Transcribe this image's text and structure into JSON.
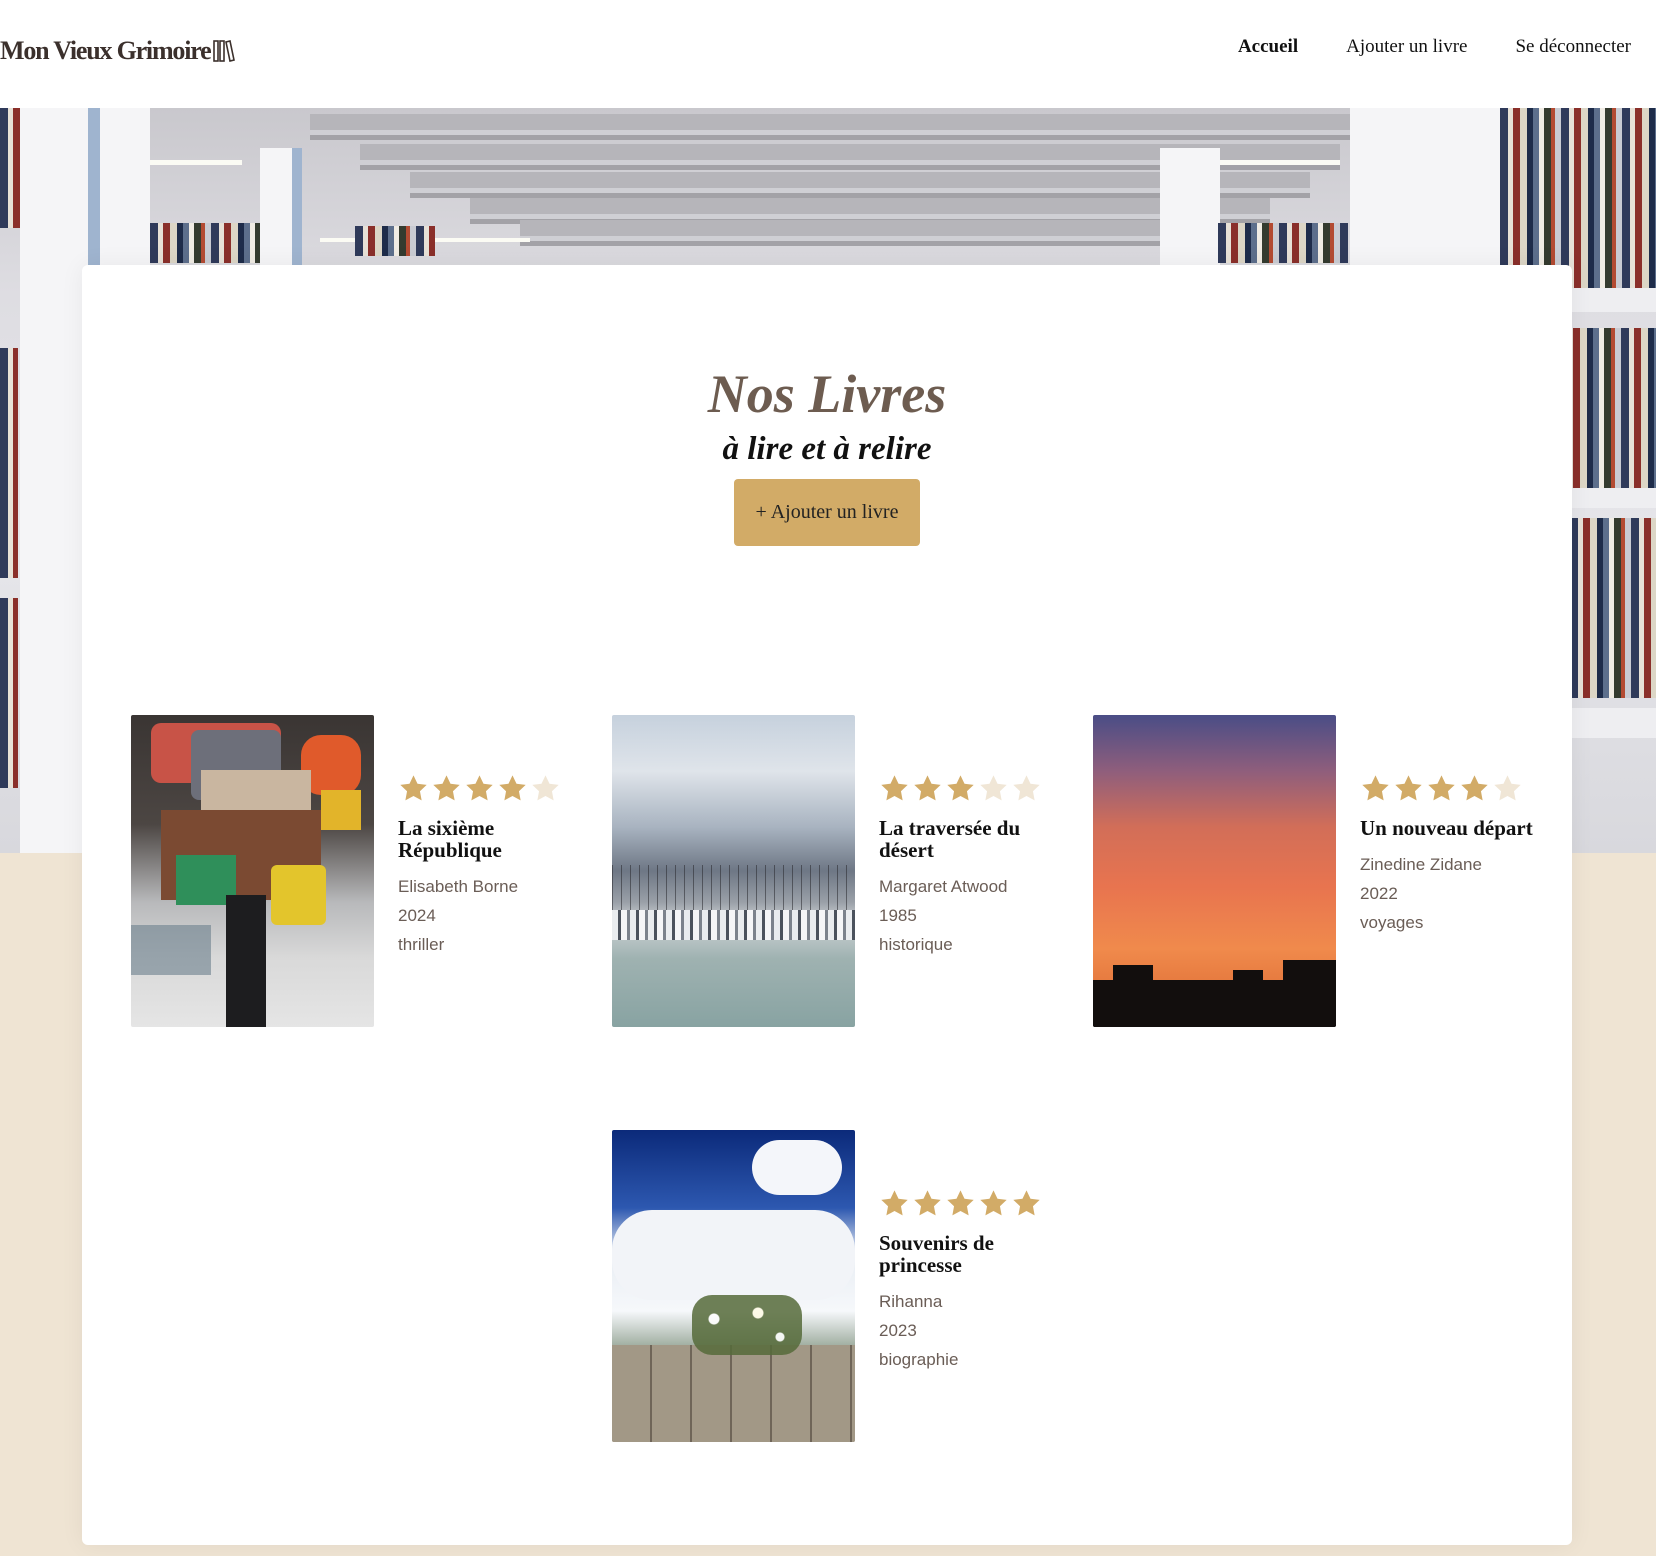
{
  "header": {
    "logo_text": "Mon Vieux Grimoire",
    "logo_icon": "books-icon",
    "nav": [
      {
        "label": "Accueil",
        "active": true
      },
      {
        "label": "Ajouter un livre",
        "active": false
      },
      {
        "label": "Se déconnecter",
        "active": false
      }
    ]
  },
  "hero": {
    "title": "Nos Livres",
    "subtitle": "à lire et à relire",
    "add_button": "+ Ajouter un livre"
  },
  "books": [
    {
      "title": "La sixième République",
      "author": "Elisabeth Borne",
      "year": "2024",
      "genre": "thriller",
      "rating": 4
    },
    {
      "title": "La traversée du désert",
      "author": "Margaret Atwood",
      "year": "1985",
      "genre": "historique",
      "rating": 3
    },
    {
      "title": "Un nouveau départ",
      "author": "Zinedine Zidane",
      "year": "2022",
      "genre": "voyages",
      "rating": 4
    },
    {
      "title": "Souvenirs de princesse",
      "author": "Rihanna",
      "year": "2023",
      "genre": "biographie",
      "rating": 5
    }
  ],
  "colors": {
    "accent": "#d2ab67",
    "star_filled": "#d2ab67",
    "star_empty": "#f0e6d6",
    "beige_background": "#efe4d3",
    "title_color": "#6d5c50",
    "meta_color": "#6a5d56"
  }
}
